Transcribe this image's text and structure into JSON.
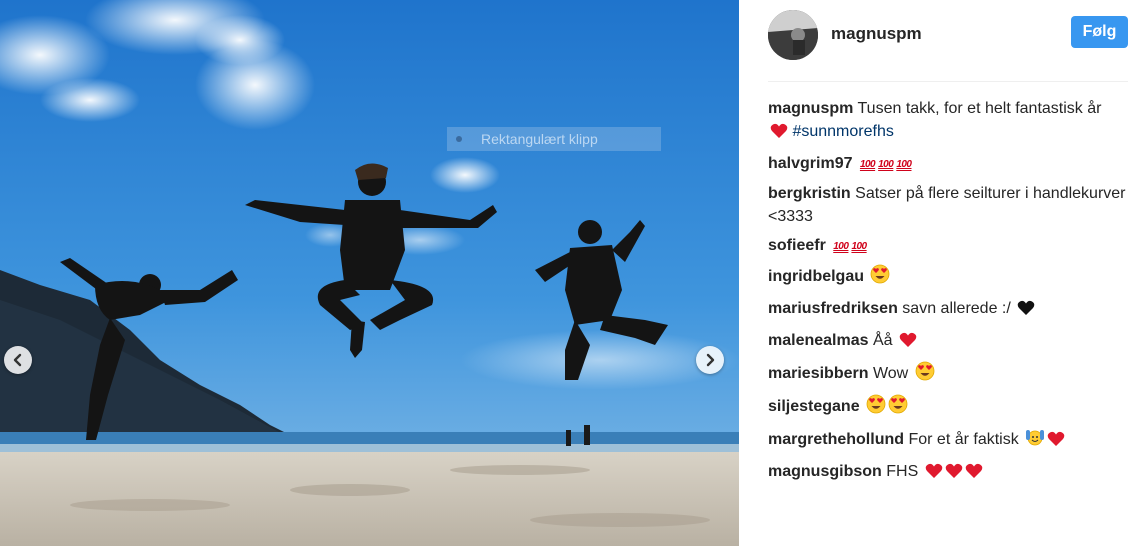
{
  "photo": {
    "overlay_text": "Rektangulært klipp"
  },
  "header": {
    "username": "magnuspm",
    "follow_label": "Følg"
  },
  "comments": [
    {
      "user": "magnuspm",
      "text": "Tusen takk, for et helt fantastisk år",
      "emojis": [
        "heart"
      ],
      "hashtag": "#sunnmorefhs"
    },
    {
      "user": "halvgrim97",
      "text": "",
      "emojis": [
        "hundred",
        "hundred",
        "hundred"
      ]
    },
    {
      "user": "bergkristin",
      "text": "Satser på flere seilturer i handlekurver <3333",
      "emojis": []
    },
    {
      "user": "sofieefr",
      "text": "",
      "emojis": [
        "hundred",
        "hundred"
      ]
    },
    {
      "user": "ingridbelgau",
      "text": "",
      "emojis": [
        "heart-eyes"
      ]
    },
    {
      "user": "mariusfredriksen",
      "text": "savn allerede :/",
      "emojis": [
        "black-heart"
      ]
    },
    {
      "user": "malenealmas",
      "text": "Åå",
      "emojis": [
        "heart"
      ]
    },
    {
      "user": "mariesibbern",
      "text": "Wow",
      "emojis": [
        "heart-eyes"
      ]
    },
    {
      "user": "siljestegane",
      "text": "",
      "emojis": [
        "heart-eyes",
        "heart-eyes"
      ]
    },
    {
      "user": "margrethehollund",
      "text": "For et år faktisk",
      "emojis": [
        "raised-hands",
        "heart"
      ]
    },
    {
      "user": "magnusgibson",
      "text": "FHS",
      "emojis": [
        "heart",
        "heart",
        "heart"
      ]
    }
  ],
  "emoji_glyphs": {
    "hundred": "100"
  },
  "colors": {
    "follow_button": "#3897f0",
    "hashtag": "#003569",
    "heart": "#e0192e",
    "sky": "#2f86d6"
  }
}
